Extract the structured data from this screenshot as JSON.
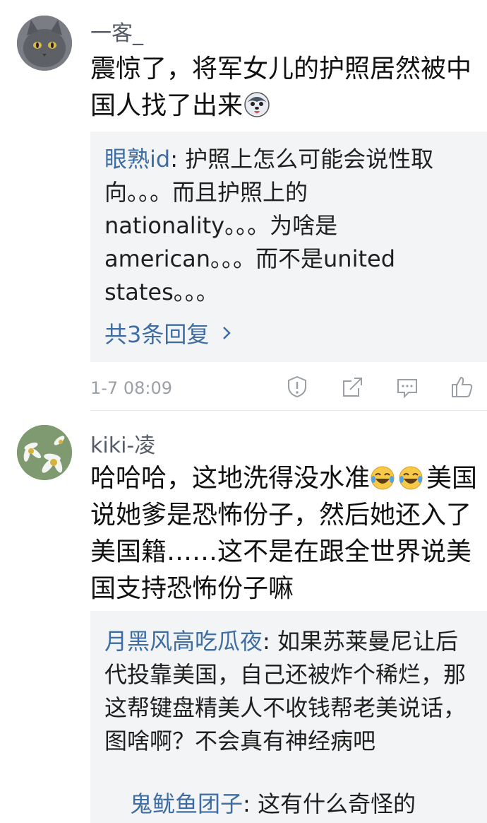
{
  "comments": [
    {
      "username": "一客_",
      "text": "震惊了，将军女儿的护照居然被中国人找了出来",
      "emoji": "husky-face-emoji",
      "reply": {
        "author": "眼熟id",
        "sep": ": ",
        "text": "护照上怎么可能会说性取向。。。而且护照上的nationality。。。为啥是american。。。而不是united states。。。",
        "more": "共3条回复"
      },
      "timestamp": "1-7 08:09",
      "actions": [
        "report-icon",
        "share-icon",
        "comment-icon",
        "like-icon"
      ]
    },
    {
      "username": "kiki-凌",
      "text_before": "哈哈哈，这地洗得没水准",
      "emoji": "laugh-cry-emoji",
      "text_after": "美国说她爹是恐怖份子，然后她还入了美国籍……这不是在跟全世界说美国支持恐怖份子嘛",
      "reply": {
        "author": "月黑风高吃瓜夜",
        "sep": ": ",
        "text": "如果苏莱曼尼让后代投靠美国，自己还被炸个稀烂，那这帮键盘精美人不收钱帮老美说话，图啥啊？不会真有神经病吧",
        "next_author": "鬼鱿鱼团子",
        "next_text": "这有什么奇怪的"
      }
    }
  ]
}
